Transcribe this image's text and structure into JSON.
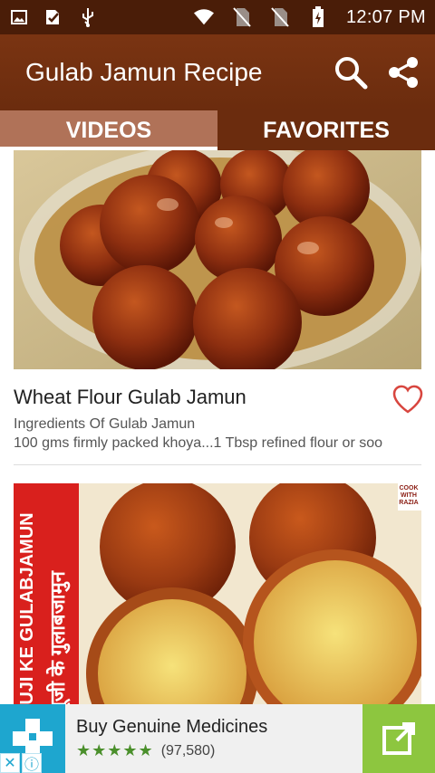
{
  "status_bar": {
    "time": "12:07 PM"
  },
  "app_bar": {
    "title": "Gulab Jamun Recipe"
  },
  "tabs": [
    {
      "label": "VIDEOS",
      "active": true
    },
    {
      "label": "FAVORITES",
      "active": false
    }
  ],
  "recipes": [
    {
      "title": "Wheat Flour Gulab Jamun",
      "subtitle_1": "Ingredients Of Gulab Jamun",
      "subtitle_2": "100 gms firmly packed khoya...1 Tbsp refined flour or soo"
    },
    {
      "image_text_vertical": "SUJI KE GULABJAMUN",
      "image_text_hindi": "सूजी के गुलाबजामुन",
      "image_badge": "COOK WITH RAZIA"
    }
  ],
  "ad": {
    "title": "Buy Genuine Medicines",
    "rating_count": "(97,580)",
    "stars": "★★★★★",
    "close_label": "✕",
    "info_label": "ⓘ"
  },
  "colors": {
    "status_bar": "#4a1d08",
    "app_bar": "#6b2c0e",
    "tab_active": "#b07258",
    "ad_icon_bg": "#1ea6cf",
    "ad_cta_bg": "#8dc63f"
  }
}
